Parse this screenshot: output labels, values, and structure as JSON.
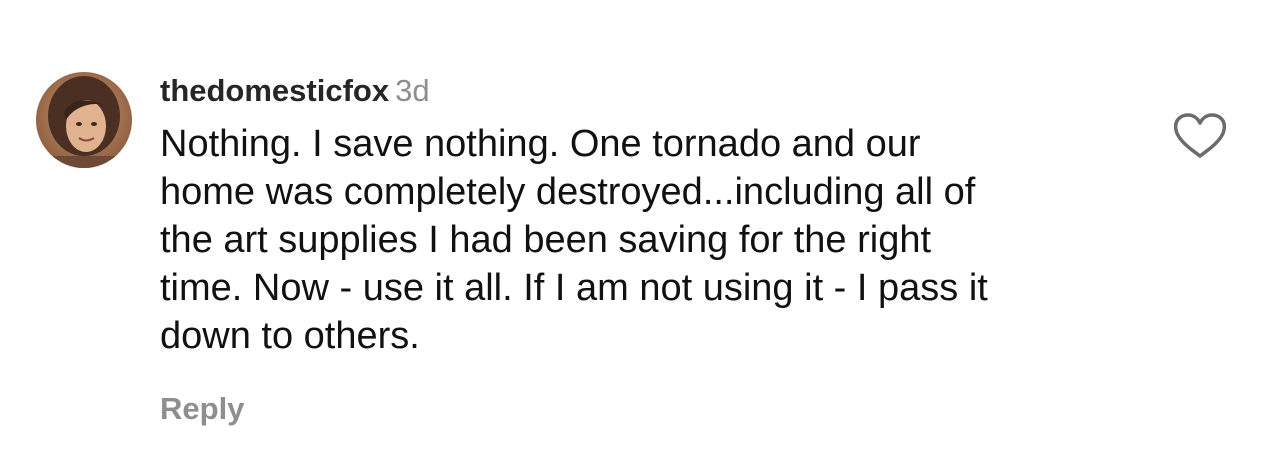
{
  "comment": {
    "username": "thedomesticfox",
    "timestamp": "3d",
    "text_lines": [
      "Nothing. I save nothing. One tornado and our",
      "home was completely destroyed...including all of",
      "the art supplies I had been saving for the right",
      "time. Now - use it all. If I am not using it - I pass it",
      "down to others."
    ],
    "reply_label": "Reply",
    "avatar_icon": "profile-photo",
    "like_icon": "heart-outline-icon"
  },
  "colors": {
    "text": "#111111",
    "username": "#262626",
    "muted": "#8e8e8e",
    "background": "#ffffff"
  }
}
